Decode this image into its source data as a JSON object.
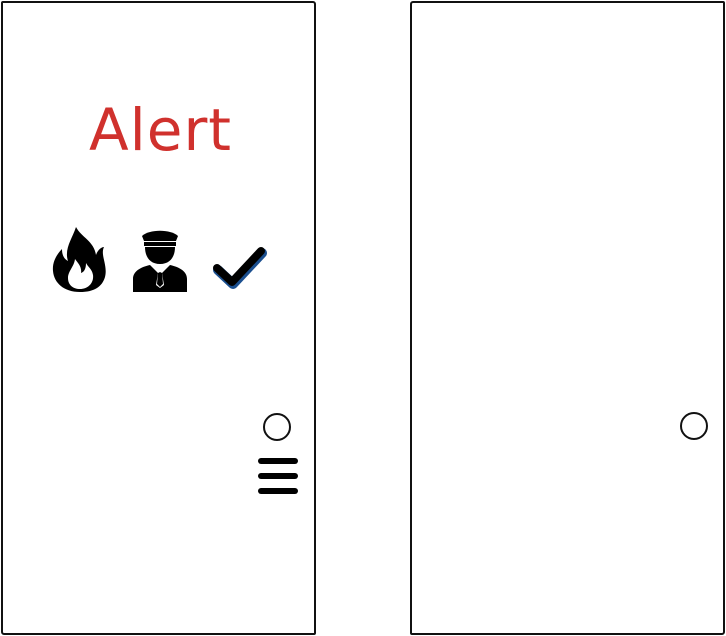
{
  "left_panel": {
    "title": "Alert",
    "title_color": "#d0312d",
    "icons": [
      "fire-icon",
      "police-officer-icon",
      "check-icon",
      "circle-button",
      "hamburger-menu-icon"
    ]
  },
  "right_panel": {
    "icons": [
      "circle-button"
    ]
  },
  "colors": {
    "stroke": "#111111",
    "background": "#ffffff",
    "alert": "#d0312d"
  }
}
